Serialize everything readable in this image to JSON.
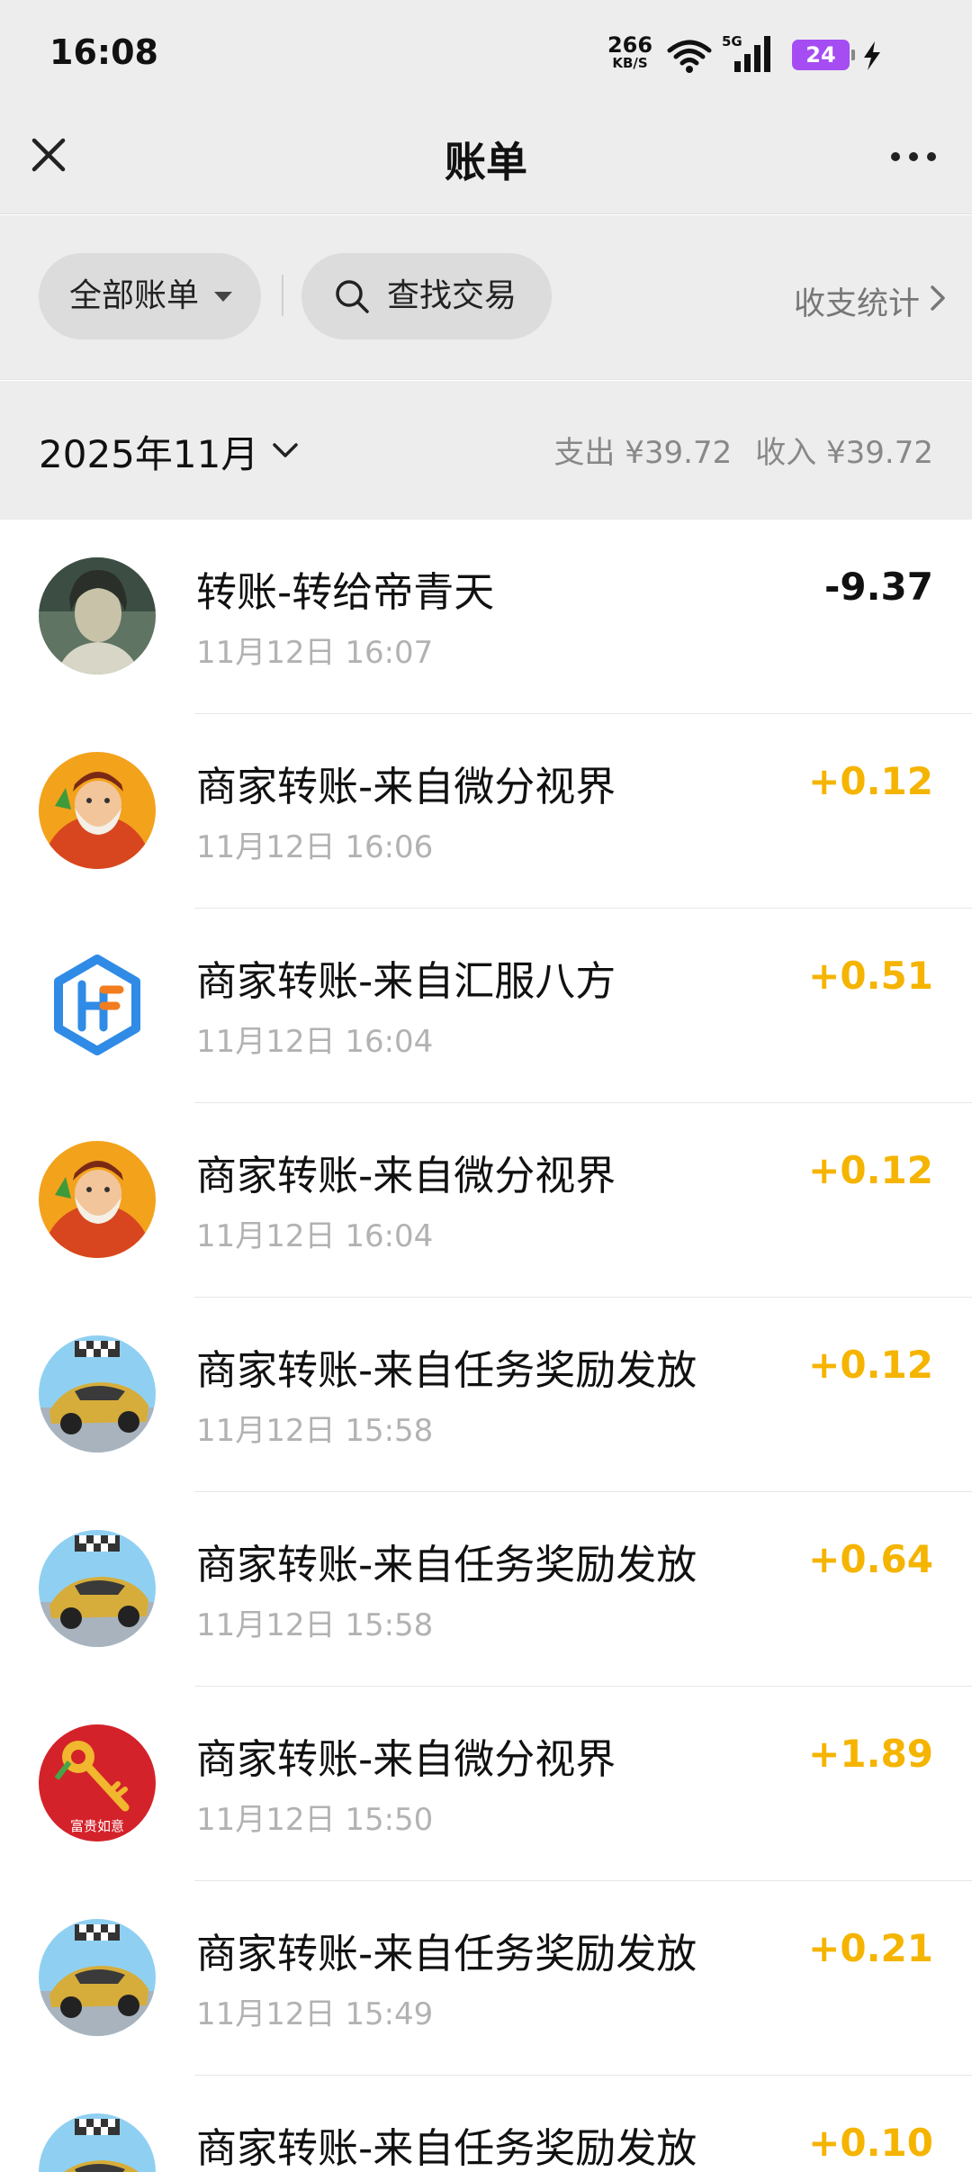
{
  "status_bar": {
    "time": "16:08",
    "net_speed": "266",
    "net_unit": "KB/S",
    "signal_tag": "5G",
    "battery": "24"
  },
  "nav": {
    "title": "账单"
  },
  "filter": {
    "all_bills": "全部账单",
    "search": "查找交易",
    "stats": "收支统计"
  },
  "month": {
    "label": "2025年11月",
    "expense": "支出 ¥39.72",
    "income": "收入 ¥39.72"
  },
  "colors": {
    "income": "#f5b400",
    "expense": "#111111",
    "battery": "#a54df2"
  },
  "transactions": [
    {
      "title": "转账-转给帝青天",
      "time": "11月12日 16:07",
      "amount": "-9.37",
      "avatar": "person-photo"
    },
    {
      "title": "商家转账-来自微分视界",
      "time": "11月12日 16:06",
      "amount": "+0.12",
      "avatar": "caishen"
    },
    {
      "title": "商家转账-来自汇服八方",
      "time": "11月12日 16:04",
      "amount": "+0.51",
      "avatar": "hf-logo"
    },
    {
      "title": "商家转账-来自微分视界",
      "time": "11月12日 16:04",
      "amount": "+0.12",
      "avatar": "caishen"
    },
    {
      "title": "商家转账-来自任务奖励发放",
      "time": "11月12日 15:58",
      "amount": "+0.12",
      "avatar": "race-car"
    },
    {
      "title": "商家转账-来自任务奖励发放",
      "time": "11月12日 15:58",
      "amount": "+0.64",
      "avatar": "race-car"
    },
    {
      "title": "商家转账-来自微分视界",
      "time": "11月12日 15:50",
      "amount": "+1.89",
      "avatar": "red-envelope",
      "avatar_text": "富贵如意"
    },
    {
      "title": "商家转账-来自任务奖励发放",
      "time": "11月12日 15:49",
      "amount": "+0.21",
      "avatar": "race-car"
    },
    {
      "title": "商家转账-来自任务奖励发放",
      "time": "",
      "amount": "+0.10",
      "avatar": "race-car"
    }
  ]
}
